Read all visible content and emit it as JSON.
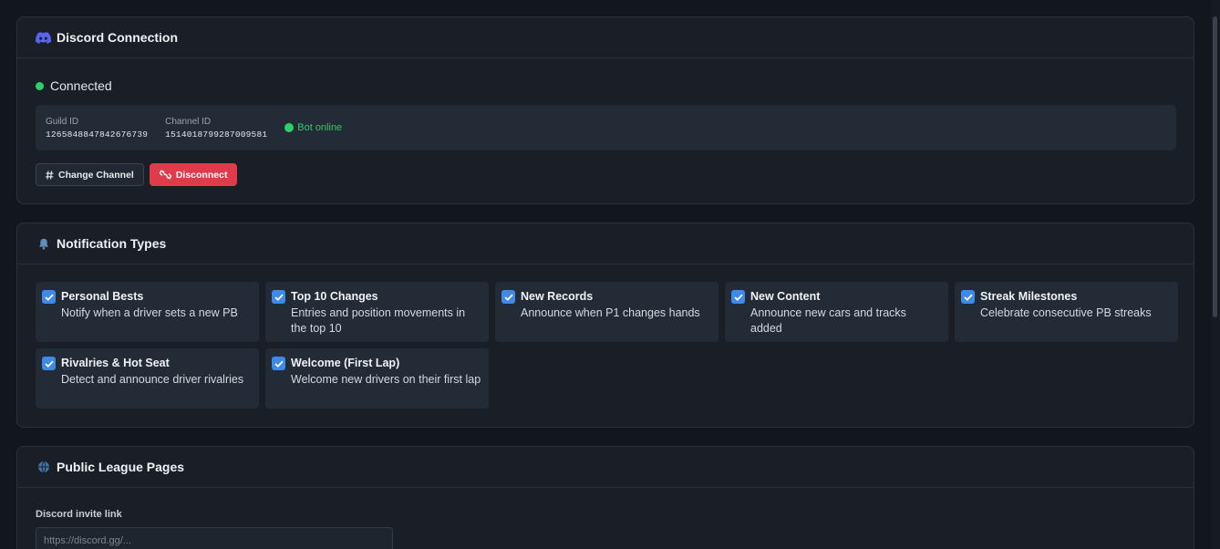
{
  "discord": {
    "title": "Discord Connection",
    "status": "Connected",
    "guild_label": "Guild ID",
    "guild_id": "1265848847842676739",
    "channel_label": "Channel ID",
    "channel_id": "1514018799287009581",
    "bot_status": "Bot online",
    "change_channel_label": "Change Channel",
    "disconnect_label": "Disconnect",
    "colors": {
      "status_green": "#2fcf6b",
      "danger": "#df3b4a",
      "discord_icon": "#5865f2"
    }
  },
  "notifications": {
    "title": "Notification Types",
    "items": [
      {
        "title": "Personal Bests",
        "desc": "Notify when a driver sets a new PB",
        "checked": true
      },
      {
        "title": "Top 10 Changes",
        "desc": "Entries and position movements in the top 10",
        "checked": true
      },
      {
        "title": "New Records",
        "desc": "Announce when P1 changes hands",
        "checked": true
      },
      {
        "title": "New Content",
        "desc": "Announce new cars and tracks added",
        "checked": true
      },
      {
        "title": "Streak Milestones",
        "desc": "Celebrate consecutive PB streaks",
        "checked": true
      },
      {
        "title": "Rivalries & Hot Seat",
        "desc": "Detect and announce driver rivalries",
        "checked": true
      },
      {
        "title": "Welcome (First Lap)",
        "desc": "Welcome new drivers on their first lap",
        "checked": true
      }
    ],
    "colors": {
      "checkbox": "#3d8ae8"
    }
  },
  "public_pages": {
    "title": "Public League Pages",
    "invite_label": "Discord invite link",
    "invite_placeholder": "https://discord.gg/...",
    "invite_value": ""
  }
}
